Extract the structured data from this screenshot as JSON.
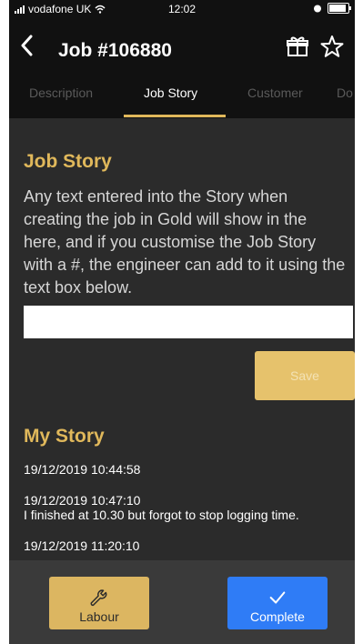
{
  "status_bar": {
    "carrier": "vodafone UK",
    "time": "12:02"
  },
  "header": {
    "title": "Job #106880",
    "back_icon": "chevron-left-icon",
    "icons": [
      "gift-icon",
      "star-icon"
    ]
  },
  "tabs": [
    {
      "label": "Description",
      "active": false
    },
    {
      "label": "Job Story",
      "active": true
    },
    {
      "label": "Customer",
      "active": false
    },
    {
      "label": "Do",
      "active": false
    }
  ],
  "job_story": {
    "heading": "Job Story",
    "text": "Any text entered into the Story when creating the job in Gold will show in the here, and if you customise the Job Story with a #, the engineer can add to it using the text box below.",
    "input_value": "",
    "save_label": "Save"
  },
  "my_story": {
    "heading": "My Story",
    "entries": [
      {
        "timestamp": "19/12/2019 10:44:58",
        "text": ""
      },
      {
        "timestamp": "19/12/2019 10:47:10",
        "text": "I finished at 10.30 but forgot to stop logging time."
      },
      {
        "timestamp": "19/12/2019 11:20:10",
        "text": ""
      }
    ]
  },
  "bottom_bar": {
    "labour_label": "Labour",
    "labour_icon": "wrench-icon",
    "complete_label": "Complete",
    "complete_icon": "checkmark-icon"
  },
  "colors": {
    "accent": "#e0b85b",
    "background": "#2b2b2b",
    "primary_button": "#2f7cf6"
  }
}
